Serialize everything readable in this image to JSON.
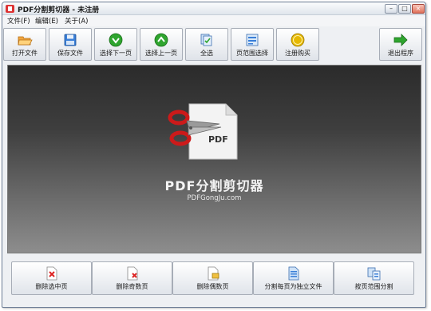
{
  "window": {
    "title": "PDF分割剪切器 - 未注册",
    "controls": {
      "minimize": "–",
      "maximize": "□",
      "close": "×"
    }
  },
  "menu": [
    {
      "label": "文件(F)"
    },
    {
      "label": "编辑(E)"
    },
    {
      "label": "关于(A)"
    }
  ],
  "toolbar": {
    "open": "打开文件",
    "save": "保存文件",
    "select_next": "选择下一页",
    "select_prev": "选择上一页",
    "select_all": "全选",
    "page_range": "页范围选择",
    "register": "注册购买",
    "exit": "退出程序"
  },
  "splash": {
    "doc_label": "PDF",
    "app_name": "PDF分割剪切器",
    "url": "PDFGongJu.com"
  },
  "bottom": {
    "delete_selected": "删除选中页",
    "delete_odd": "删除奇数页",
    "delete_even": "删除偶数页",
    "split_each": "分割每页为独立文件",
    "split_by_range": "按页范围分割"
  },
  "colors": {
    "accent_green": "#2fa52f",
    "scissors_red": "#cc1a1a",
    "folder_orange": "#f0a640",
    "save_blue": "#3a7fd8",
    "coin_gold": "#e6b800"
  },
  "icons": {
    "open": "folder-open-icon",
    "save": "floppy-disk-icon",
    "next": "green-down-arrow-icon",
    "prev": "green-up-arrow-icon",
    "select_all": "pages-stack-icon",
    "range": "page-range-icon",
    "register": "gold-coin-icon",
    "exit": "green-right-arrow-icon"
  }
}
